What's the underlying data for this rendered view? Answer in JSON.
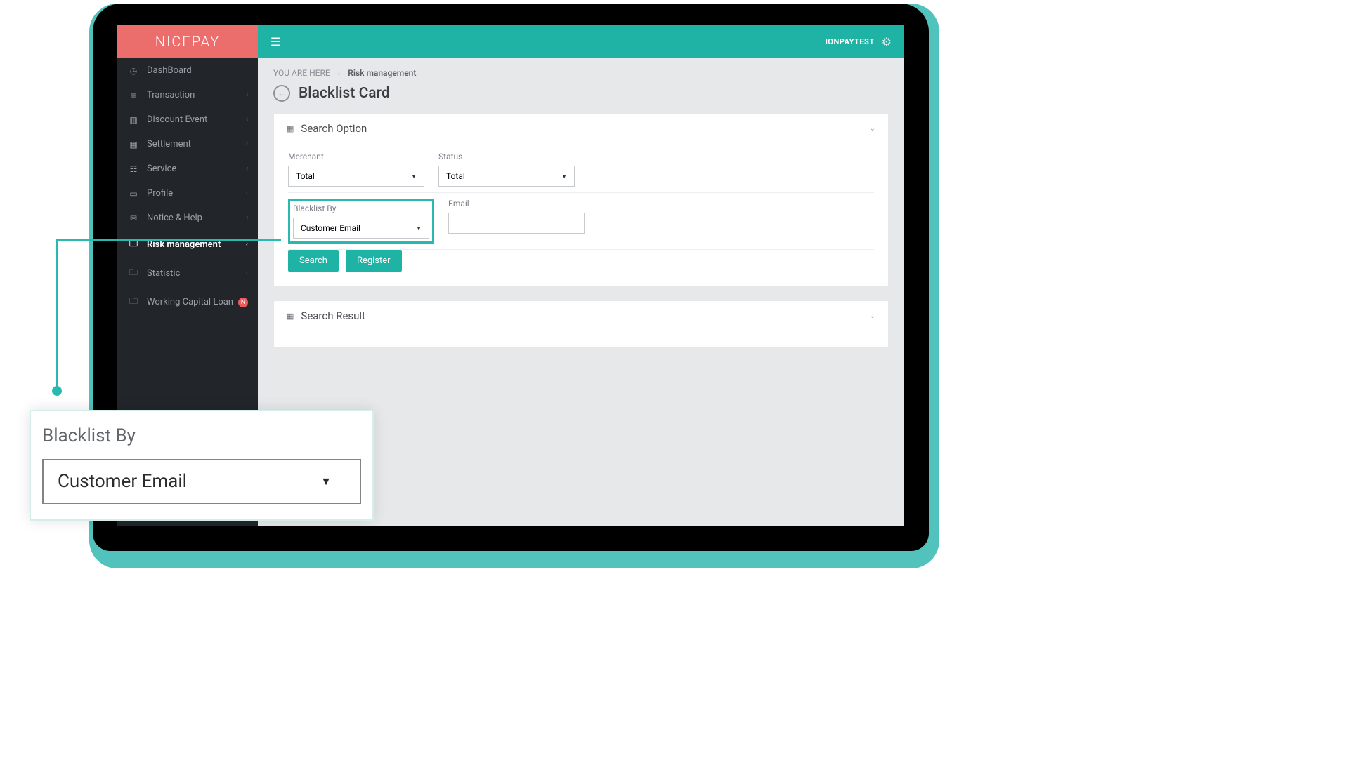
{
  "brand": "NICEPAY",
  "user": "IONPAYTEST",
  "breadcrumb": {
    "prefix": "YOU ARE HERE",
    "current": "Risk management"
  },
  "page_title": "Blacklist Card",
  "sidebar": {
    "items": [
      {
        "label": "DashBoard",
        "icon": "dashboard-icon"
      },
      {
        "label": "Transaction",
        "icon": "transaction-icon"
      },
      {
        "label": "Discount Event",
        "icon": "discount-icon"
      },
      {
        "label": "Settlement",
        "icon": "settlement-icon"
      },
      {
        "label": "Service",
        "icon": "service-icon"
      },
      {
        "label": "Profile",
        "icon": "profile-icon"
      },
      {
        "label": "Notice & Help",
        "icon": "notice-icon"
      },
      {
        "label": "Risk management",
        "icon": "risk-icon",
        "active": true
      },
      {
        "label": "Statistic",
        "icon": "statistic-icon"
      },
      {
        "label": "Working Capital Loan",
        "icon": "loan-icon",
        "badge": "N"
      }
    ]
  },
  "panels": {
    "search_option": {
      "title": "Search Option",
      "fields": {
        "merchant": {
          "label": "Merchant",
          "value": "Total"
        },
        "status": {
          "label": "Status",
          "value": "Total"
        },
        "blacklist_by": {
          "label": "Blacklist By",
          "value": "Customer Email"
        },
        "email": {
          "label": "Email",
          "value": ""
        }
      },
      "buttons": {
        "search": "Search",
        "register": "Register"
      }
    },
    "search_result": {
      "title": "Search Result"
    }
  },
  "callout": {
    "label": "Blacklist By",
    "value": "Customer Email"
  }
}
